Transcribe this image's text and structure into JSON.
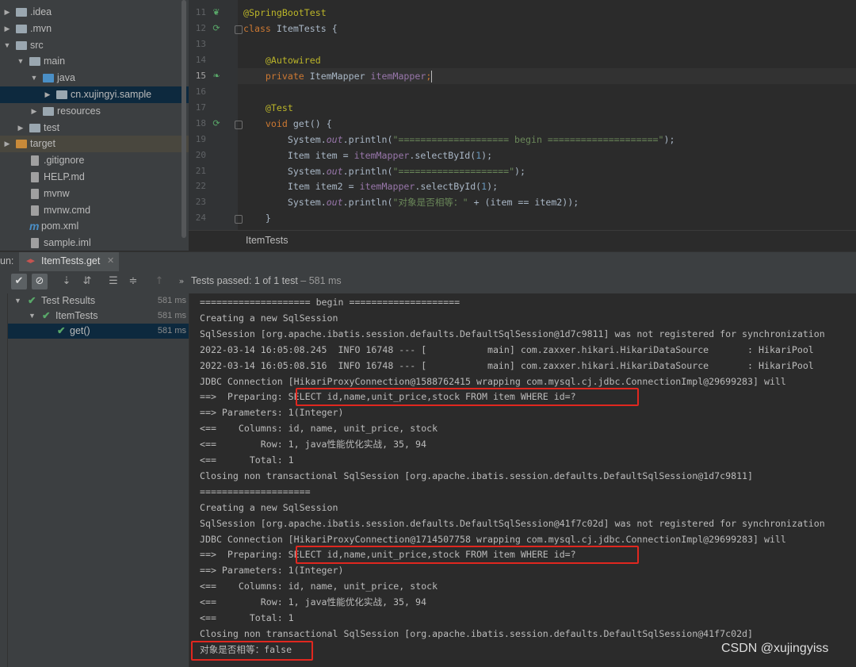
{
  "project_tree": {
    "items": [
      {
        "label": ".idea",
        "expanded": false
      },
      {
        "label": ".mvn",
        "expanded": false
      },
      {
        "label": "src",
        "expanded": true
      },
      {
        "label": "main",
        "expanded": true
      },
      {
        "label": "java",
        "expanded": true
      },
      {
        "label": "cn.xujingyi.sample",
        "expanded": false,
        "selected": true
      },
      {
        "label": "resources",
        "expanded": false
      },
      {
        "label": "test",
        "expanded": false
      },
      {
        "label": "target",
        "expanded": false
      },
      {
        "label": ".gitignore"
      },
      {
        "label": "HELP.md"
      },
      {
        "label": "mvnw"
      },
      {
        "label": "mvnw.cmd"
      },
      {
        "label": "pom.xml",
        "icon_letter": "m"
      },
      {
        "label": "sample.iml"
      }
    ]
  },
  "editor": {
    "line_numbers": [
      "11",
      "12",
      "13",
      "14",
      "15",
      "16",
      "17",
      "18",
      "19",
      "20",
      "21",
      "22",
      "23",
      "24"
    ],
    "current_line": "15",
    "breadcrumb": "ItemTests",
    "lines": [
      [
        {
          "t": "@SpringBootTest",
          "c": "ann"
        }
      ],
      [
        {
          "t": "class ",
          "c": "kw"
        },
        {
          "t": "ItemTests {",
          "c": ""
        }
      ],
      [],
      [
        {
          "t": "    @Autowired",
          "c": "ann"
        }
      ],
      [
        {
          "t": "    private ",
          "c": "kw"
        },
        {
          "t": "ItemMapper ",
          "c": ""
        },
        {
          "t": "itemMapper",
          "c": "fld"
        },
        {
          "t": ";",
          "c": "kw"
        }
      ],
      [],
      [
        {
          "t": "    @Test",
          "c": "ann"
        }
      ],
      [
        {
          "t": "    void ",
          "c": "kw"
        },
        {
          "t": "get() {",
          "c": ""
        }
      ],
      [
        {
          "t": "        System.",
          "c": ""
        },
        {
          "t": "out",
          "c": "fldi"
        },
        {
          "t": ".println(",
          "c": ""
        },
        {
          "t": "\"==================== begin ====================\"",
          "c": "str"
        },
        {
          "t": ");",
          "c": ""
        }
      ],
      [
        {
          "t": "        Item item = ",
          "c": ""
        },
        {
          "t": "itemMapper",
          "c": "fld"
        },
        {
          "t": ".selectById(",
          "c": ""
        },
        {
          "t": "1",
          "c": "num"
        },
        {
          "t": ");",
          "c": ""
        }
      ],
      [
        {
          "t": "        System.",
          "c": ""
        },
        {
          "t": "out",
          "c": "fldi"
        },
        {
          "t": ".println(",
          "c": ""
        },
        {
          "t": "\"====================\"",
          "c": "str"
        },
        {
          "t": ");",
          "c": ""
        }
      ],
      [
        {
          "t": "        Item item2 = ",
          "c": ""
        },
        {
          "t": "itemMapper",
          "c": "fld"
        },
        {
          "t": ".selectById(",
          "c": ""
        },
        {
          "t": "1",
          "c": "num"
        },
        {
          "t": ");",
          "c": ""
        }
      ],
      [
        {
          "t": "        System.",
          "c": ""
        },
        {
          "t": "out",
          "c": "fldi"
        },
        {
          "t": ".println(",
          "c": ""
        },
        {
          "t": "\"对象是否相等：\" ",
          "c": "str"
        },
        {
          "t": "+ (item == item2));",
          "c": ""
        }
      ],
      [
        {
          "t": "    }",
          "c": ""
        }
      ]
    ]
  },
  "run_window": {
    "label": "un:",
    "tab_label": "ItemTests.get",
    "tests_passed": "Tests passed: 1 of 1 test",
    "tests_time": " – 581 ms"
  },
  "test_results": [
    {
      "label": "Test Results",
      "time": "581 ms"
    },
    {
      "label": "ItemTests",
      "time": "581 ms"
    },
    {
      "label": "get()",
      "time": "581 ms"
    }
  ],
  "console": {
    "lines": [
      "==================== begin ====================",
      "Creating a new SqlSession",
      "SqlSession [org.apache.ibatis.session.defaults.DefaultSqlSession@1d7c9811] was not registered for synchronization",
      "2022-03-14 16:05:08.245  INFO 16748 --- [           main] com.zaxxer.hikari.HikariDataSource       : HikariPool",
      "2022-03-14 16:05:08.516  INFO 16748 --- [           main] com.zaxxer.hikari.HikariDataSource       : HikariPool",
      "JDBC Connection [HikariProxyConnection@1588762415 wrapping com.mysql.cj.jdbc.ConnectionImpl@29699283] will",
      "==>  Preparing: SELECT id,name,unit_price,stock FROM item WHERE id=?",
      "==> Parameters: 1(Integer)",
      "<==    Columns: id, name, unit_price, stock",
      "<==        Row: 1, java性能优化实战, 35, 94",
      "<==      Total: 1",
      "Closing non transactional SqlSession [org.apache.ibatis.session.defaults.DefaultSqlSession@1d7c9811]",
      "====================",
      "Creating a new SqlSession",
      "SqlSession [org.apache.ibatis.session.defaults.DefaultSqlSession@41f7c02d] was not registered for synchronization",
      "JDBC Connection [HikariProxyConnection@1714507758 wrapping com.mysql.cj.jdbc.ConnectionImpl@29699283] will",
      "==>  Preparing: SELECT id,name,unit_price,stock FROM item WHERE id=?",
      "==> Parameters: 1(Integer)",
      "<==    Columns: id, name, unit_price, stock",
      "<==        Row: 1, java性能优化实战, 35, 94",
      "<==      Total: 1",
      "Closing non transactional SqlSession [org.apache.ibatis.session.defaults.DefaultSqlSession@41f7c02d]",
      "对象是否相等：false"
    ]
  },
  "watermark": "CSDN @xujingyiss",
  "colors": {
    "highlight_box": "#e0271f",
    "pass_green": "#59a869"
  }
}
